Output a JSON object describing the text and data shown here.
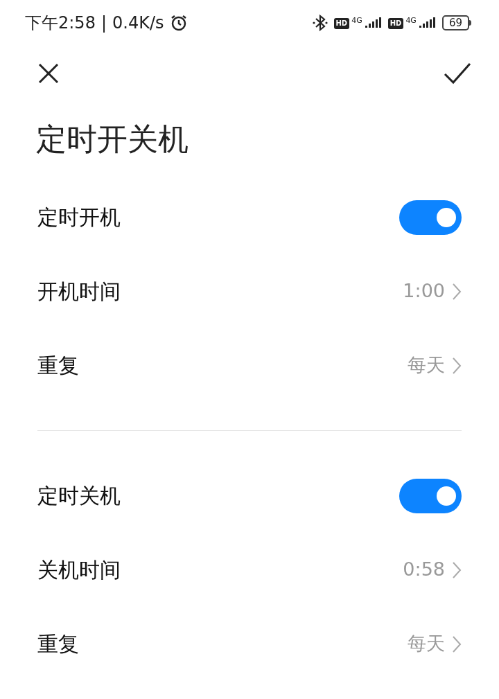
{
  "status_bar": {
    "time": "下午2:58",
    "separator": "|",
    "speed": "0.4K/s",
    "sims": [
      {
        "badge": "HD",
        "network": "4G"
      },
      {
        "badge": "HD",
        "network": "4G"
      }
    ],
    "battery": "69"
  },
  "title": "定时开关机",
  "sections": [
    {
      "items": [
        {
          "kind": "toggle",
          "label": "定时开机",
          "on": true
        },
        {
          "kind": "value",
          "label": "开机时间",
          "value": "1:00"
        },
        {
          "kind": "value",
          "label": "重复",
          "value": "每天"
        }
      ]
    },
    {
      "items": [
        {
          "kind": "toggle",
          "label": "定时关机",
          "on": true
        },
        {
          "kind": "value",
          "label": "关机时间",
          "value": "0:58"
        },
        {
          "kind": "value",
          "label": "重复",
          "value": "每天"
        }
      ]
    }
  ]
}
